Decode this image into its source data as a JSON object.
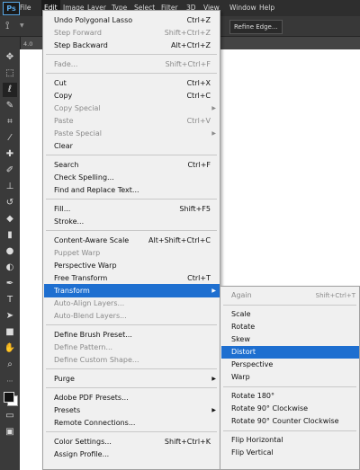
{
  "app": {
    "logo": "Ps"
  },
  "menubar": [
    "File",
    "Edit",
    "Image",
    "Layer",
    "Type",
    "Select",
    "Filter",
    "3D",
    "View",
    "Window",
    "Help"
  ],
  "options_bar": {
    "partial_text": "Refine Edge..."
  },
  "document_tab": "4.0",
  "edit_menu": [
    {
      "label": "Undo Polygonal Lasso",
      "shortcut": "Ctrl+Z"
    },
    {
      "label": "Step Forward",
      "shortcut": "Shift+Ctrl+Z",
      "disabled": true
    },
    {
      "label": "Step Backward",
      "shortcut": "Alt+Ctrl+Z"
    },
    {
      "separator": true
    },
    {
      "label": "Fade...",
      "shortcut": "Shift+Ctrl+F",
      "disabled": true
    },
    {
      "separator": true
    },
    {
      "label": "Cut",
      "shortcut": "Ctrl+X"
    },
    {
      "label": "Copy",
      "shortcut": "Ctrl+C"
    },
    {
      "label": "Copy Special",
      "submenu": true,
      "disabled": true
    },
    {
      "label": "Paste",
      "shortcut": "Ctrl+V",
      "disabled": true
    },
    {
      "label": "Paste Special",
      "submenu": true,
      "disabled": true
    },
    {
      "label": "Clear"
    },
    {
      "separator": true
    },
    {
      "label": "Search",
      "shortcut": "Ctrl+F"
    },
    {
      "label": "Check Spelling..."
    },
    {
      "label": "Find and Replace Text..."
    },
    {
      "separator": true
    },
    {
      "label": "Fill...",
      "shortcut": "Shift+F5"
    },
    {
      "label": "Stroke..."
    },
    {
      "separator": true
    },
    {
      "label": "Content-Aware Scale",
      "shortcut": "Alt+Shift+Ctrl+C"
    },
    {
      "label": "Puppet Warp",
      "disabled": true
    },
    {
      "label": "Perspective Warp"
    },
    {
      "label": "Free Transform",
      "shortcut": "Ctrl+T"
    },
    {
      "label": "Transform",
      "submenu": true,
      "highlighted": true
    },
    {
      "label": "Auto-Align Layers...",
      "disabled": true
    },
    {
      "label": "Auto-Blend Layers...",
      "disabled": true
    },
    {
      "separator": true
    },
    {
      "label": "Define Brush Preset..."
    },
    {
      "label": "Define Pattern...",
      "disabled": true
    },
    {
      "label": "Define Custom Shape...",
      "disabled": true
    },
    {
      "separator": true
    },
    {
      "label": "Purge",
      "submenu": true
    },
    {
      "separator": true
    },
    {
      "label": "Adobe PDF Presets..."
    },
    {
      "label": "Presets",
      "submenu": true
    },
    {
      "label": "Remote Connections..."
    },
    {
      "separator": true
    },
    {
      "label": "Color Settings...",
      "shortcut": "Shift+Ctrl+K"
    },
    {
      "label": "Assign Profile..."
    }
  ],
  "transform_submenu": [
    {
      "label": "Again",
      "shortcut": "Shift+Ctrl+T",
      "disabled": true
    },
    {
      "separator": true
    },
    {
      "label": "Scale"
    },
    {
      "label": "Rotate"
    },
    {
      "label": "Skew"
    },
    {
      "label": "Distort",
      "highlighted": true
    },
    {
      "label": "Perspective"
    },
    {
      "label": "Warp"
    },
    {
      "separator": true
    },
    {
      "label": "Rotate 180°"
    },
    {
      "label": "Rotate 90° Clockwise"
    },
    {
      "label": "Rotate 90° Counter Clockwise"
    },
    {
      "separator": true
    },
    {
      "label": "Flip Horizontal"
    },
    {
      "label": "Flip Vertical"
    }
  ],
  "toolbox": [
    "move-tool",
    "marquee-tool",
    "lasso-tool",
    "quick-select-tool",
    "crop-tool",
    "eyedropper-tool",
    "healing-tool",
    "brush-tool",
    "clone-stamp-tool",
    "history-brush-tool",
    "eraser-tool",
    "gradient-tool",
    "blur-tool",
    "dodge-tool",
    "pen-tool",
    "type-tool",
    "path-select-tool",
    "shape-tool",
    "hand-tool",
    "zoom-tool"
  ],
  "colors": {
    "highlight": "#1e6fd0",
    "menu_bg": "#f0f0f0",
    "chrome": "#2e2e2e",
    "disabled": "#8a8a8a"
  }
}
